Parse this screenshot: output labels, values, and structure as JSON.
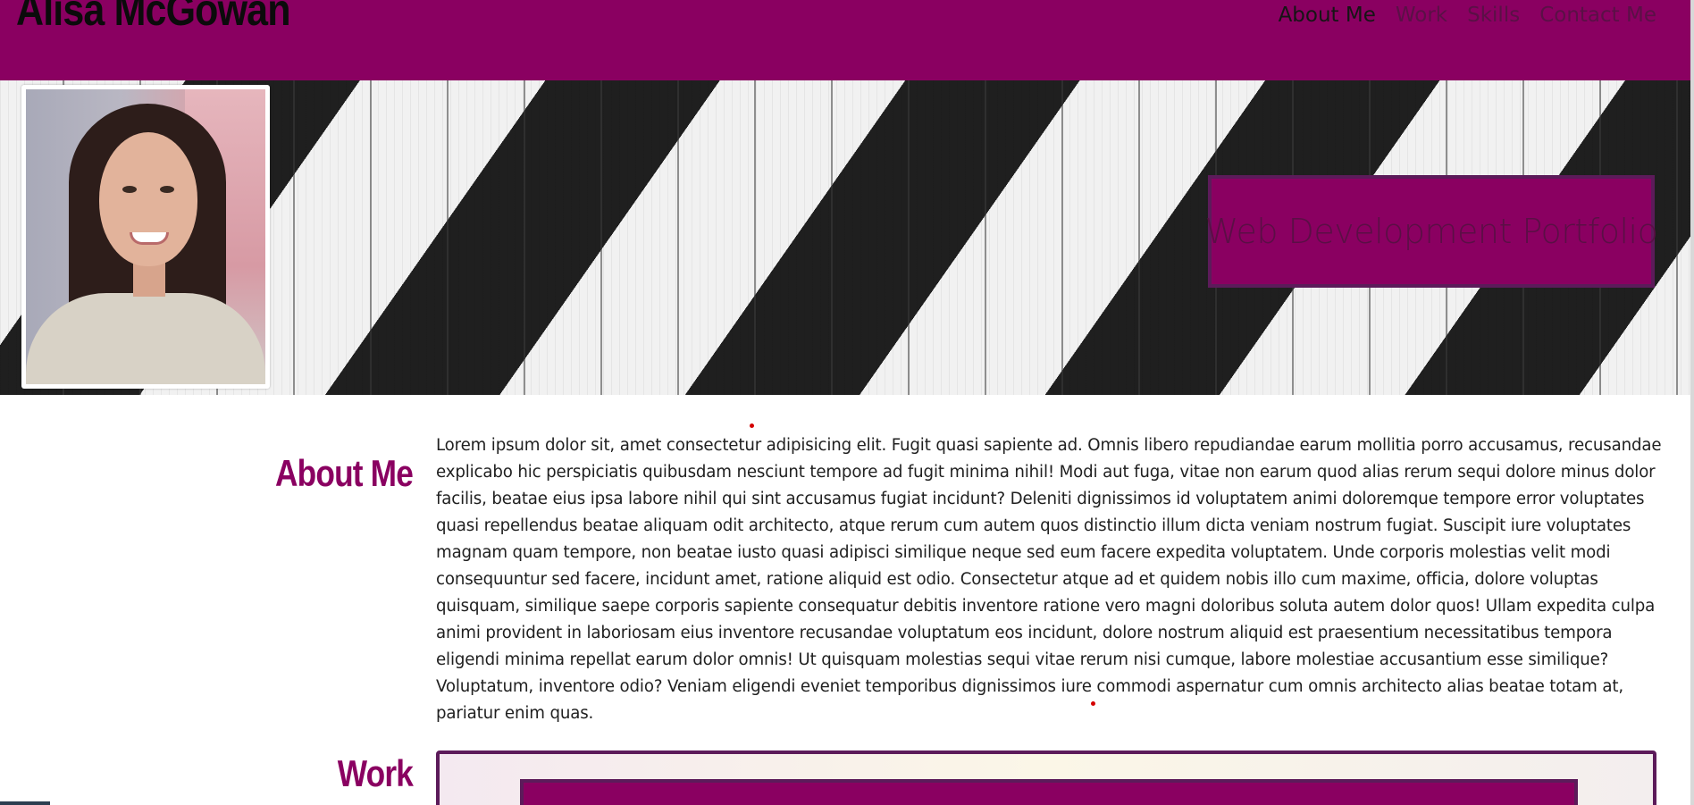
{
  "header": {
    "name": "Alisa McGowan",
    "nav": [
      {
        "label": "About Me",
        "active": true
      },
      {
        "label": "Work",
        "active": false
      },
      {
        "label": "Skills",
        "active": false
      },
      {
        "label": "Contact Me",
        "active": false
      }
    ]
  },
  "hero": {
    "title": "Web Development Portfolio"
  },
  "about": {
    "heading": "About Me",
    "text": "Lorem ipsum dolor sit, amet consectetur adipisicing elit. Fugit quasi sapiente ad. Omnis libero repudiandae earum mollitia porro accusamus, recusandae explicabo hic perspiciatis quibusdam nesciunt tempore ad fugit minima nihil! Modi aut fuga, vitae non earum quod alias rerum sequi dolore minus dolor facilis, beatae eius ipsa labore nihil qui sint accusamus fugiat incidunt? Deleniti dignissimos id voluptatem animi doloremque tempore error voluptates quasi repellendus beatae aliquam odit architecto, atque rerum cum autem quos distinctio illum dicta veniam nostrum fugiat. Suscipit iure voluptates magnam quam tempore, non beatae iusto quasi adipisci similique neque sed eum facere expedita voluptatem. Unde corporis molestias velit modi consequuntur sed facere, incidunt amet, ratione aliquid est odio. Consectetur atque ad et quidem nobis illo cum maxime, officia, dolore voluptas quisquam, similique saepe corporis sapiente consequatur debitis inventore ratione vero magni doloribus soluta autem dolor quos! Ullam expedita culpa animi provident in laboriosam eius inventore recusandae voluptatum eos incidunt, dolore nostrum aliquid est praesentium necessitatibus tempora eligendi minima repellat earum dolor omnis! Ut quisquam molestias sequi vitae rerum nisi cumque, labore molestiae accusantium esse similique? Voluptatum, inventore odio? Veniam eligendi eveniet temporibus dignissimos iure commodi aspernatur cum omnis architecto alias beatae totam at, pariatur enim quas."
  },
  "work": {
    "heading": "Work"
  },
  "colors": {
    "brand": "#8a0061",
    "brand_border": "#5c1b5a",
    "header_text": "#0b0b0b"
  }
}
